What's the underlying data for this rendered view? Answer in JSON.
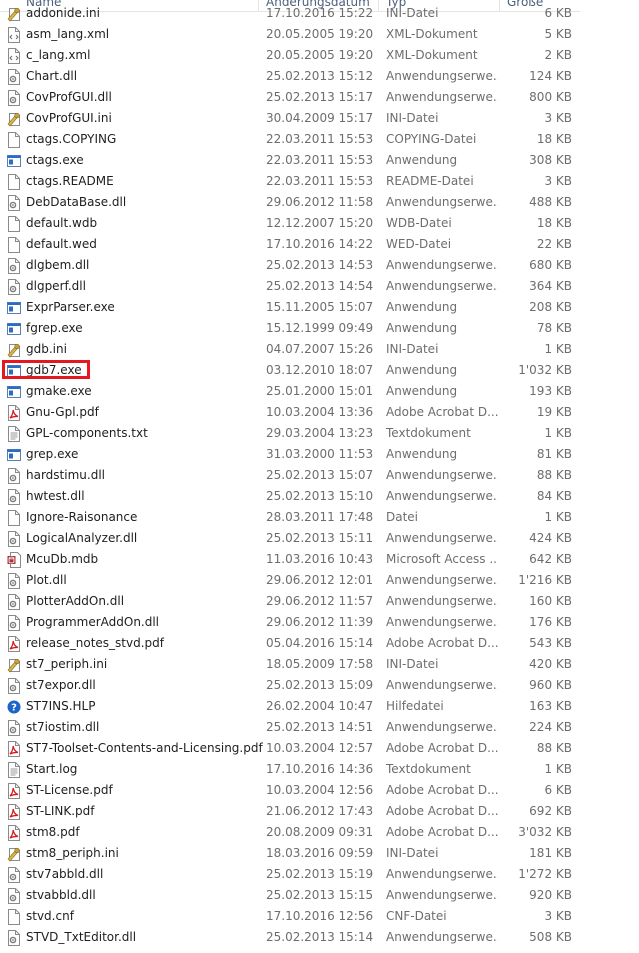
{
  "columns": {
    "name": "Name",
    "date": "Änderungsdatum",
    "type": "Typ",
    "size": "Größe"
  },
  "files": [
    {
      "name": "addonide.ini",
      "date": "17.10.2016 15:22",
      "type": "INI-Datei",
      "size": "6 KB",
      "icon": "ini-settings-icon"
    },
    {
      "name": "asm_lang.xml",
      "date": "20.05.2005 19:20",
      "type": "XML-Dokument",
      "size": "5 KB",
      "icon": "xml-file-icon"
    },
    {
      "name": "c_lang.xml",
      "date": "20.05.2005 19:20",
      "type": "XML-Dokument",
      "size": "2 KB",
      "icon": "xml-file-icon"
    },
    {
      "name": "Chart.dll",
      "date": "25.02.2013 15:12",
      "type": "Anwendungserwe...",
      "size": "124 KB",
      "icon": "dll-file-icon"
    },
    {
      "name": "CovProfGUI.dll",
      "date": "25.02.2013 15:17",
      "type": "Anwendungserwe...",
      "size": "800 KB",
      "icon": "dll-file-icon"
    },
    {
      "name": "CovProfGUI.ini",
      "date": "30.04.2009 15:17",
      "type": "INI-Datei",
      "size": "3 KB",
      "icon": "ini-settings-icon"
    },
    {
      "name": "ctags.COPYING",
      "date": "22.03.2011 15:53",
      "type": "COPYING-Datei",
      "size": "18 KB",
      "icon": "blank-file-icon"
    },
    {
      "name": "ctags.exe",
      "date": "22.03.2011 15:53",
      "type": "Anwendung",
      "size": "308 KB",
      "icon": "exe-file-icon"
    },
    {
      "name": "ctags.README",
      "date": "22.03.2011 15:53",
      "type": "README-Datei",
      "size": "3 KB",
      "icon": "blank-file-icon"
    },
    {
      "name": "DebDataBase.dll",
      "date": "29.06.2012 11:58",
      "type": "Anwendungserwe...",
      "size": "488 KB",
      "icon": "dll-file-icon"
    },
    {
      "name": "default.wdb",
      "date": "12.12.2007 15:20",
      "type": "WDB-Datei",
      "size": "18 KB",
      "icon": "blank-file-icon"
    },
    {
      "name": "default.wed",
      "date": "17.10.2016 14:22",
      "type": "WED-Datei",
      "size": "22 KB",
      "icon": "blank-file-icon"
    },
    {
      "name": "dlgbem.dll",
      "date": "25.02.2013 14:53",
      "type": "Anwendungserwe...",
      "size": "680 KB",
      "icon": "dll-file-icon"
    },
    {
      "name": "dlgperf.dll",
      "date": "25.02.2013 14:54",
      "type": "Anwendungserwe...",
      "size": "364 KB",
      "icon": "dll-file-icon"
    },
    {
      "name": "ExprParser.exe",
      "date": "15.11.2005 15:07",
      "type": "Anwendung",
      "size": "208 KB",
      "icon": "exe-file-icon"
    },
    {
      "name": "fgrep.exe",
      "date": "15.12.1999 09:49",
      "type": "Anwendung",
      "size": "78 KB",
      "icon": "exe-file-icon"
    },
    {
      "name": "gdb.ini",
      "date": "04.07.2007 15:26",
      "type": "INI-Datei",
      "size": "1 KB",
      "icon": "ini-settings-icon"
    },
    {
      "name": "gdb7.exe",
      "date": "03.12.2010 18:07",
      "type": "Anwendung",
      "size": "1'032 KB",
      "icon": "exe-file-icon"
    },
    {
      "name": "gmake.exe",
      "date": "25.01.2000 15:01",
      "type": "Anwendung",
      "size": "193 KB",
      "icon": "exe-file-icon"
    },
    {
      "name": "Gnu-Gpl.pdf",
      "date": "10.03.2004 13:36",
      "type": "Adobe Acrobat D...",
      "size": "19 KB",
      "icon": "pdf-file-icon"
    },
    {
      "name": "GPL-components.txt",
      "date": "29.03.2004 13:23",
      "type": "Textdokument",
      "size": "1 KB",
      "icon": "text-file-icon"
    },
    {
      "name": "grep.exe",
      "date": "31.03.2000 11:53",
      "type": "Anwendung",
      "size": "81 KB",
      "icon": "exe-file-icon"
    },
    {
      "name": "hardstimu.dll",
      "date": "25.02.2013 15:07",
      "type": "Anwendungserwe...",
      "size": "88 KB",
      "icon": "dll-file-icon"
    },
    {
      "name": "hwtest.dll",
      "date": "25.02.2013 15:10",
      "type": "Anwendungserwe...",
      "size": "84 KB",
      "icon": "dll-file-icon"
    },
    {
      "name": "Ignore-Raisonance",
      "date": "28.03.2011 17:48",
      "type": "Datei",
      "size": "1 KB",
      "icon": "blank-file-icon"
    },
    {
      "name": "LogicalAnalyzer.dll",
      "date": "25.02.2013 15:11",
      "type": "Anwendungserwe...",
      "size": "424 KB",
      "icon": "dll-file-icon"
    },
    {
      "name": "McuDb.mdb",
      "date": "11.03.2016 10:43",
      "type": "Microsoft Access ...",
      "size": "642 KB",
      "icon": "access-db-icon"
    },
    {
      "name": "Plot.dll",
      "date": "29.06.2012 12:01",
      "type": "Anwendungserwe...",
      "size": "1'216 KB",
      "icon": "dll-file-icon"
    },
    {
      "name": "PlotterAddOn.dll",
      "date": "29.06.2012 11:57",
      "type": "Anwendungserwe...",
      "size": "160 KB",
      "icon": "dll-file-icon"
    },
    {
      "name": "ProgrammerAddOn.dll",
      "date": "29.06.2012 11:39",
      "type": "Anwendungserwe...",
      "size": "176 KB",
      "icon": "dll-file-icon"
    },
    {
      "name": "release_notes_stvd.pdf",
      "date": "05.04.2016 15:14",
      "type": "Adobe Acrobat D...",
      "size": "543 KB",
      "icon": "pdf-file-icon"
    },
    {
      "name": "st7_periph.ini",
      "date": "18.05.2009 17:58",
      "type": "INI-Datei",
      "size": "420 KB",
      "icon": "ini-settings-icon"
    },
    {
      "name": "st7expor.dll",
      "date": "25.02.2013 15:09",
      "type": "Anwendungserwe...",
      "size": "960 KB",
      "icon": "dll-file-icon"
    },
    {
      "name": "ST7INS.HLP",
      "date": "26.02.2004 10:47",
      "type": "Hilfedatei",
      "size": "163 KB",
      "icon": "help-file-icon"
    },
    {
      "name": "st7iostim.dll",
      "date": "25.02.2013 14:51",
      "type": "Anwendungserwe...",
      "size": "224 KB",
      "icon": "dll-file-icon"
    },
    {
      "name": "ST7-Toolset-Contents-and-Licensing.pdf",
      "date": "10.03.2004 12:57",
      "type": "Adobe Acrobat D...",
      "size": "88 KB",
      "icon": "pdf-file-icon"
    },
    {
      "name": "Start.log",
      "date": "17.10.2016 14:36",
      "type": "Textdokument",
      "size": "1 KB",
      "icon": "text-file-icon"
    },
    {
      "name": "ST-License.pdf",
      "date": "10.03.2004 12:56",
      "type": "Adobe Acrobat D...",
      "size": "6 KB",
      "icon": "pdf-file-icon"
    },
    {
      "name": "ST-LINK.pdf",
      "date": "21.06.2012 17:43",
      "type": "Adobe Acrobat D...",
      "size": "692 KB",
      "icon": "pdf-file-icon"
    },
    {
      "name": "stm8.pdf",
      "date": "20.08.2009 09:31",
      "type": "Adobe Acrobat D...",
      "size": "3'032 KB",
      "icon": "pdf-file-icon"
    },
    {
      "name": "stm8_periph.ini",
      "date": "18.03.2016 09:59",
      "type": "INI-Datei",
      "size": "181 KB",
      "icon": "ini-settings-icon"
    },
    {
      "name": "stv7abbld.dll",
      "date": "25.02.2013 15:19",
      "type": "Anwendungserwe...",
      "size": "1'272 KB",
      "icon": "dll-file-icon"
    },
    {
      "name": "stvabbld.dll",
      "date": "25.02.2013 15:15",
      "type": "Anwendungserwe...",
      "size": "920 KB",
      "icon": "dll-file-icon"
    },
    {
      "name": "stvd.cnf",
      "date": "17.10.2016 12:56",
      "type": "CNF-Datei",
      "size": "3 KB",
      "icon": "blank-file-icon"
    },
    {
      "name": "STVD_TxtEditor.dll",
      "date": "25.02.2013 15:14",
      "type": "Anwendungserwe...",
      "size": "508 KB",
      "icon": "dll-file-icon"
    }
  ],
  "highlighted_file": "gdb7.exe",
  "colors": {
    "highlight_border": "#e5171f",
    "exe_blue": "#2b6cc4",
    "pdf_red": "#d21f1f"
  }
}
